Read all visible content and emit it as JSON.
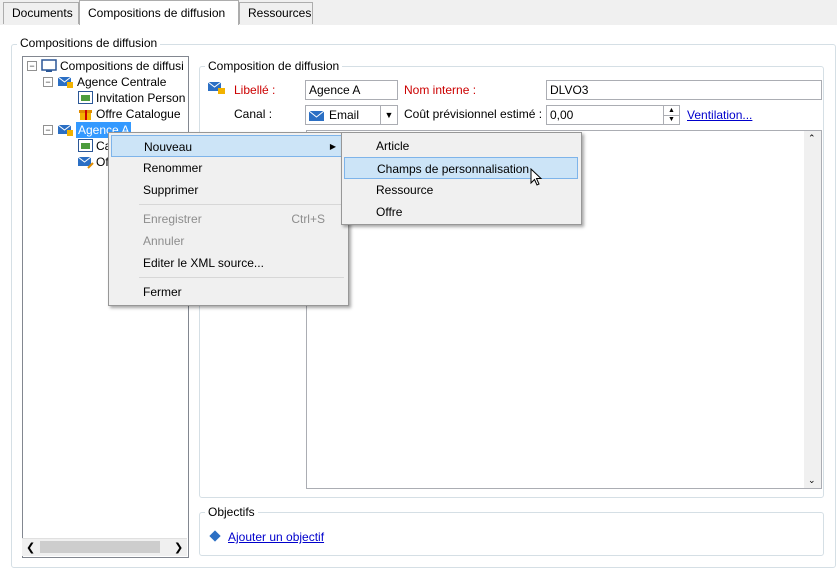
{
  "tabs": [
    {
      "label": "Documents"
    },
    {
      "label": "Compositions de diffusion"
    },
    {
      "label": "Ressources"
    }
  ],
  "main_group_title": "Compositions de diffusion",
  "tree": {
    "root": "Compositions de diffusi",
    "items": [
      {
        "label": "Agence Centrale"
      },
      {
        "label": "Invitation Person"
      },
      {
        "label": "Offre Catalogue"
      },
      {
        "label": "Agence A"
      },
      {
        "label": "Ca"
      },
      {
        "label": "Of"
      }
    ]
  },
  "form": {
    "group_title": "Composition de diffusion",
    "libelle_label": "Libellé :",
    "libelle_value": "Agence A",
    "nom_interne_label": "Nom interne :",
    "nom_interne_value": "DLVO3",
    "canal_label": "Canal :",
    "canal_value": "Email",
    "cout_label": "Coût prévisionnel estimé :",
    "cout_value": "0,00",
    "ventilation_link": "Ventilation..."
  },
  "objectifs": {
    "title": "Objectifs",
    "add_link": "Ajouter un objectif"
  },
  "context_menu": {
    "items": [
      {
        "label": "Nouveau",
        "shortcut": "",
        "disabled": false
      },
      {
        "label": "Renommer",
        "shortcut": "",
        "disabled": false
      },
      {
        "label": "Supprimer",
        "shortcut": "",
        "disabled": false
      },
      {
        "label": "Enregistrer",
        "shortcut": "Ctrl+S",
        "disabled": true
      },
      {
        "label": "Annuler",
        "shortcut": "",
        "disabled": true
      },
      {
        "label": "Editer le XML source...",
        "shortcut": "",
        "disabled": false
      },
      {
        "label": "Fermer",
        "shortcut": "",
        "disabled": false
      }
    ]
  },
  "submenu": {
    "items": [
      {
        "label": "Article"
      },
      {
        "label": "Champs de personnalisation"
      },
      {
        "label": "Ressource"
      },
      {
        "label": "Offre"
      }
    ]
  },
  "colors": {
    "selection": "#3399ff",
    "menu_highlight": "#cce4f7",
    "required_label": "#cc0000",
    "link": "#0000cc"
  }
}
